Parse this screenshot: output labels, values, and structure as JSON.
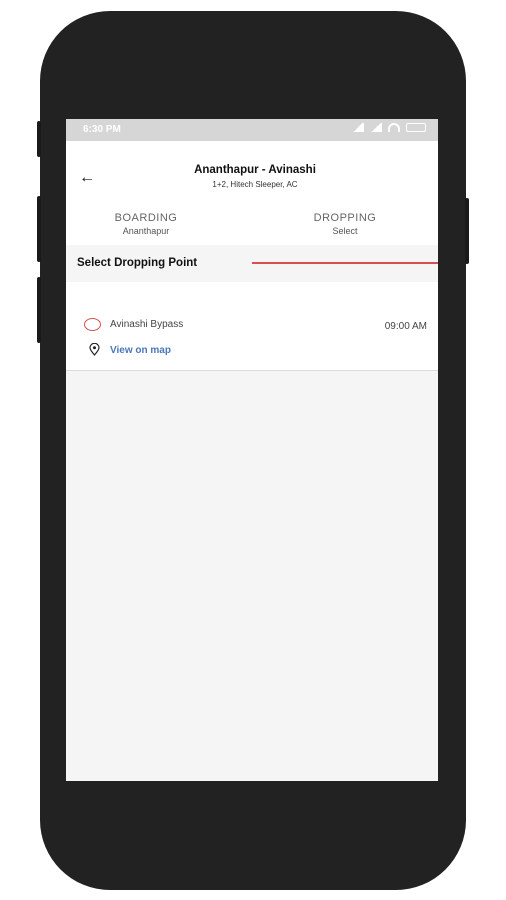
{
  "status_bar": {
    "time": "6:30 PM",
    "icons": [
      "cellular-signal-icon",
      "cellular-signal-icon",
      "wifi-icon",
      "battery-icon"
    ]
  },
  "header": {
    "back_icon": "arrow-left-icon",
    "route": "Ananthapur - Avinashi",
    "bus_info": "1+2, Hitech Sleeper, AC"
  },
  "tabs": [
    {
      "label": "BOARDING",
      "value": "Ananthapur",
      "active": false
    },
    {
      "label": "DROPPING",
      "value": "Select",
      "active": true
    }
  ],
  "section_title": "Select Dropping Point",
  "dropping_points": [
    {
      "name": "Avinashi Bypass",
      "time": "09:00 AM",
      "map_link": "View on map",
      "selected": false
    }
  ],
  "colors": {
    "accent": "#d84f4f",
    "link": "#4a76b8",
    "frame": "#222222",
    "status_bar": "#d6d6d6"
  }
}
